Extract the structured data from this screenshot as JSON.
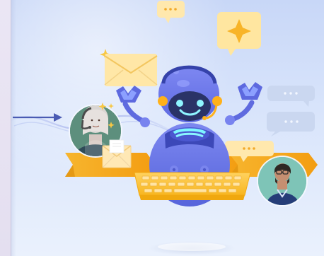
{
  "scene": {
    "background_top": "#c8d7f7",
    "background_bottom": "#eaf1fd",
    "left_panel": "#ebe6f4",
    "arrow_color": "#4a5bb3",
    "ribbon_color": "#f6a81f",
    "robot_primary": "#6674e8",
    "robot_dark": "#3c48b8",
    "robot_face": "#2a3367",
    "robot_eye_and_smile": "#8ff5ff",
    "keyboard_color": "#ffc43d",
    "envelope_color": "#ffe7a7",
    "bubble_cream": "#ffe8ad",
    "bubble_blue_gray": "#c9d6ef",
    "sparkle_color": "#f7c744",
    "left_avatar_bg": "#5d8f7d",
    "right_avatar_bg": "#7ec4b7"
  },
  "icons": {
    "arrow": "arrow-right-icon",
    "ribbon": "ribbon-banner-icon",
    "robot": "robot-assistant-icon",
    "headset": "headset-icon",
    "keyboard": "keyboard-icon",
    "left_envelope": "envelope-icon",
    "floating_envelope": "envelope-icon",
    "sparkle": "sparkle-icon",
    "chat_bubbles": "chat-bubble-icon",
    "left_avatar": "customer-avatar-icon",
    "right_avatar": "agent-avatar-icon"
  }
}
